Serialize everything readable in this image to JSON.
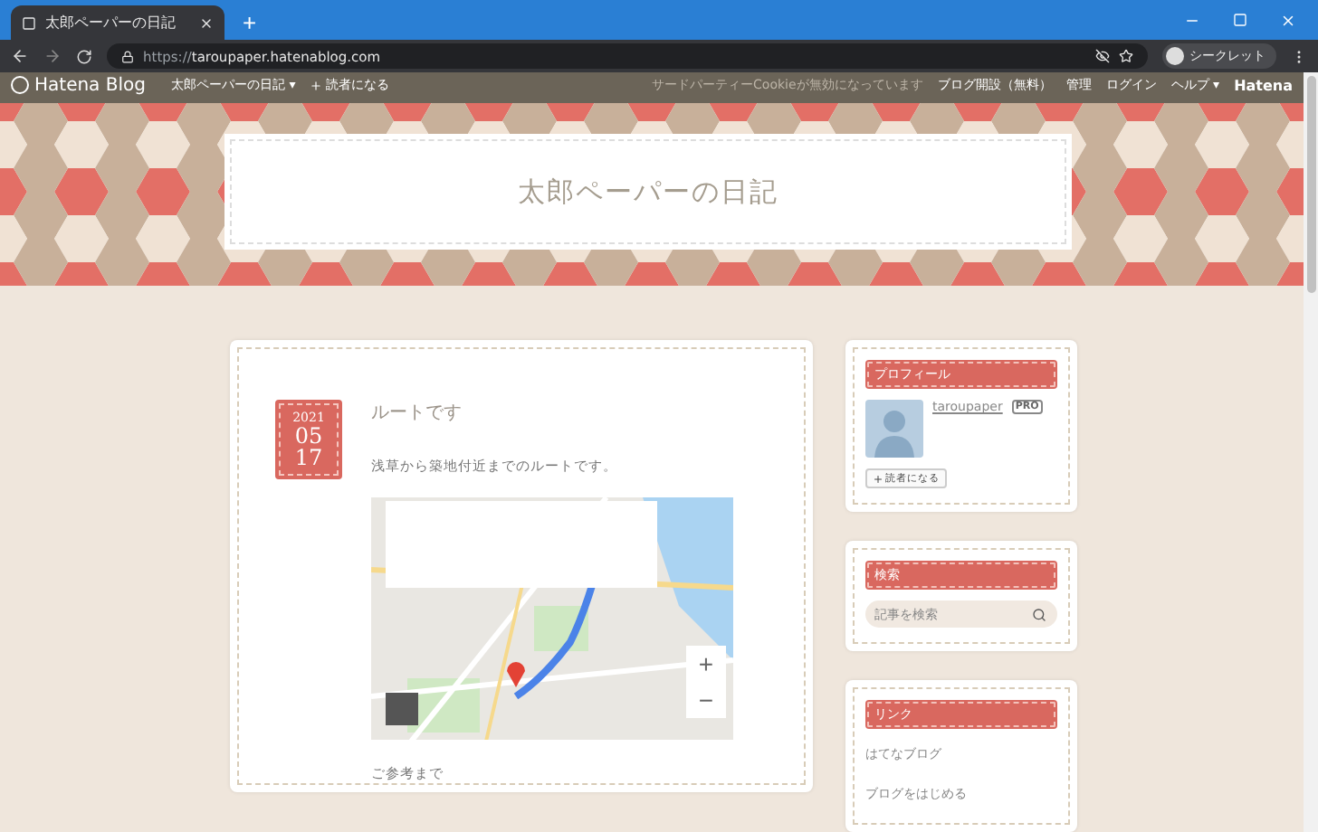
{
  "browser": {
    "tab_title": "太郎ペーパーの日記",
    "new_tab": "+",
    "url_scheme": "https://",
    "url_host": "taroupaper.hatenablog.com",
    "incognito": "シークレット"
  },
  "hatena_bar": {
    "logo": "Hatena Blog",
    "blog_menu": "太郎ペーパーの日記",
    "caret": "▾",
    "subscribe": "読者になる",
    "notice": "サードパーティーCookieが無効になっています",
    "links": [
      {
        "label": "ブログ開設（無料）"
      },
      {
        "label": "管理"
      },
      {
        "label": "ログイン"
      },
      {
        "label": "ヘルプ",
        "caret": "▾"
      }
    ],
    "hatena": "Hatena"
  },
  "blog_title": "太郎ペーパーの日記",
  "post": {
    "date": {
      "year": "2021",
      "month": "05",
      "day": "17"
    },
    "title": "ルートです",
    "body": "浅草から築地付近までのルートです。",
    "map": {
      "kind": "picture",
      "zoom_in": "+",
      "zoom_out": "−"
    },
    "after": "ご参考まで"
  },
  "sidebar": [
    {
      "kind": "profile",
      "title": "プロフィール",
      "user": "taroupaper",
      "badge": "PRO",
      "follow": "読者になる"
    },
    {
      "kind": "search",
      "title": "検索",
      "placeholder": "記事を検索"
    },
    {
      "kind": "links",
      "title": "リンク",
      "items": [
        "はてなブログ",
        "ブログをはじめる"
      ]
    }
  ]
}
